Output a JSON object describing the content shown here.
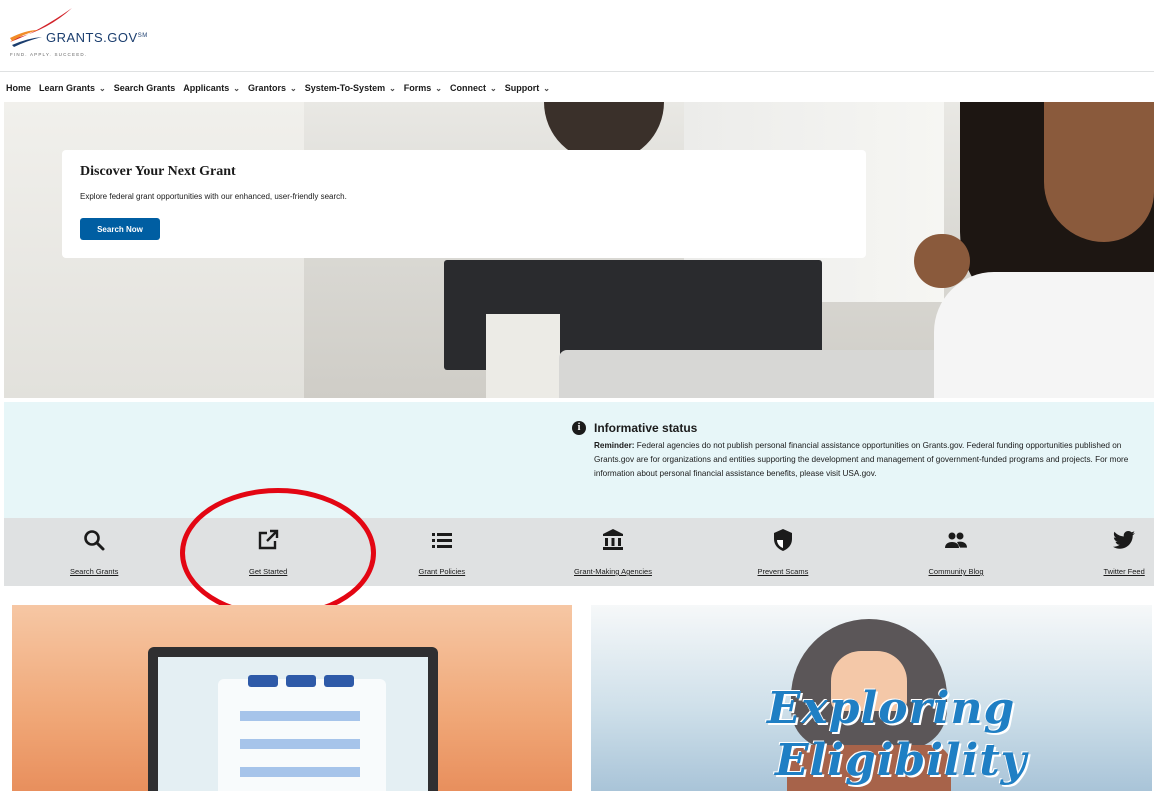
{
  "header": {
    "logo_name": "GRANTS.GOV",
    "logo_sup": "SM",
    "logo_tagline": "FIND. APPLY. SUCCEED."
  },
  "nav": {
    "items": [
      {
        "label": "Home",
        "dropdown": false
      },
      {
        "label": "Learn Grants",
        "dropdown": true
      },
      {
        "label": "Search Grants",
        "dropdown": false
      },
      {
        "label": "Applicants",
        "dropdown": true
      },
      {
        "label": "Grantors",
        "dropdown": true
      },
      {
        "label": "System-To-System",
        "dropdown": true
      },
      {
        "label": "Forms",
        "dropdown": true
      },
      {
        "label": "Connect",
        "dropdown": true
      },
      {
        "label": "Support",
        "dropdown": true
      }
    ]
  },
  "hero": {
    "title": "Discover Your Next Grant",
    "description": "Explore federal grant opportunities with our enhanced, user-friendly search.",
    "button_label": "Search Now"
  },
  "alert": {
    "icon": "i",
    "title": "Informative status",
    "reminder_label": "Reminder:",
    "body": " Federal agencies do not publish personal financial assistance opportunities on Grants.gov. Federal funding opportunities published on Grants.gov are for organizations and entities supporting the development and management of government-funded programs and projects. For more information about personal financial assistance benefits, please visit USA.gov."
  },
  "quick_links": [
    {
      "label": "Search Grants",
      "icon": "search-icon"
    },
    {
      "label": "Get Started",
      "icon": "external-link-icon"
    },
    {
      "label": "Grant Policies",
      "icon": "list-icon"
    },
    {
      "label": "Grant-Making Agencies",
      "icon": "bank-icon"
    },
    {
      "label": "Prevent Scams",
      "icon": "shield-icon"
    },
    {
      "label": "Community Blog",
      "icon": "people-icon"
    },
    {
      "label": "Twitter Feed",
      "icon": "twitter-icon"
    }
  ],
  "cards": {
    "right_line1": "Exploring",
    "right_line2": "Eligibility"
  },
  "colors": {
    "primary": "#005ea2",
    "alert_bg": "#e7f6f8",
    "quicklinks_bg": "#dfe1e2",
    "highlight": "#e30613"
  }
}
